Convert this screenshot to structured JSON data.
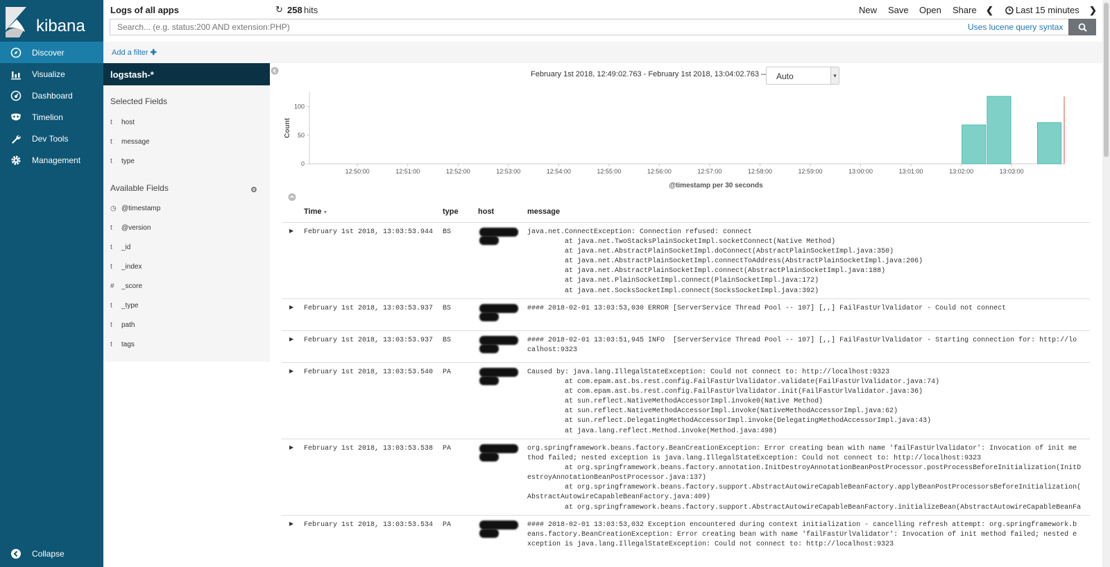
{
  "sidebar": {
    "logo": "kibana",
    "items": [
      {
        "label": "Discover",
        "icon": "compass-icon",
        "active": true
      },
      {
        "label": "Visualize",
        "icon": "bar-chart-icon",
        "active": false
      },
      {
        "label": "Dashboard",
        "icon": "dashboard-icon",
        "active": false
      },
      {
        "label": "Timelion",
        "icon": "timelion-mask-icon",
        "active": false
      },
      {
        "label": "Dev Tools",
        "icon": "wrench-icon",
        "active": false
      },
      {
        "label": "Management",
        "icon": "gear-icon",
        "active": false
      }
    ],
    "collapse_label": "Collapse"
  },
  "topbar": {
    "title": "Logs of all apps",
    "hits_count": "258",
    "hits_label": "hits",
    "new": "New",
    "save": "Save",
    "open": "Open",
    "share": "Share",
    "time_range": "Last 15 minutes"
  },
  "search": {
    "placeholder": "Search... (e.g. status:200 AND extension:PHP)",
    "syntax_link": "Uses lucene query syntax"
  },
  "filters": {
    "add_label": "Add a filter"
  },
  "fieldpanel": {
    "index_pattern": "logstash-*",
    "selected_title": "Selected Fields",
    "selected": [
      {
        "type": "t",
        "name": "host"
      },
      {
        "type": "t",
        "name": "message"
      },
      {
        "type": "t",
        "name": "type"
      }
    ],
    "available_title": "Available Fields",
    "available": [
      {
        "type": "clock",
        "name": "@timestamp"
      },
      {
        "type": "t",
        "name": "@version"
      },
      {
        "type": "t",
        "name": "_id"
      },
      {
        "type": "t",
        "name": "_index"
      },
      {
        "type": "#",
        "name": "_score"
      },
      {
        "type": "t",
        "name": "_type"
      },
      {
        "type": "t",
        "name": "path"
      },
      {
        "type": "t",
        "name": "tags"
      }
    ]
  },
  "histogram": {
    "date_range": "February 1st 2018, 12:49:02.763 - February 1st 2018, 13:04:02.763 —",
    "interval": "Auto"
  },
  "chart_data": {
    "type": "bar",
    "ylabel": "Count",
    "xlabel": "@timestamp per 30 seconds",
    "ylim": [
      0,
      125
    ],
    "yticks": [
      0,
      50,
      100
    ],
    "x_ticks": [
      "12:50:00",
      "12:51:00",
      "12:52:00",
      "12:53:00",
      "12:54:00",
      "12:55:00",
      "12:56:00",
      "12:57:00",
      "12:58:00",
      "12:59:00",
      "13:00:00",
      "13:01:00",
      "13:02:00",
      "13:03:00"
    ],
    "x_range_seconds": [
      0,
      900
    ],
    "bars": [
      {
        "start": "13:02:00",
        "value": 68
      },
      {
        "start": "13:02:30",
        "value": 118
      },
      {
        "start": "13:03:30",
        "value": 72
      }
    ],
    "color": "#7fd1c7",
    "now_marker_color": "#e74c3c"
  },
  "table": {
    "headers": {
      "time": "Time",
      "type": "type",
      "host": "host",
      "message": "message"
    },
    "rows": [
      {
        "time": "February 1st 2018, 13:03:53.944",
        "type": "BS",
        "message": "java.net.ConnectException: Connection refused: connect\n\tat java.net.TwoStacksPlainSocketImpl.socketConnect(Native Method)\n\tat java.net.AbstractPlainSocketImpl.doConnect(AbstractPlainSocketImpl.java:350)\n\tat java.net.AbstractPlainSocketImpl.connectToAddress(AbstractPlainSocketImpl.java:206)\n\tat java.net.AbstractPlainSocketImpl.connect(AbstractPlainSocketImpl.java:188)\n\tat java.net.PlainSocketImpl.connect(PlainSocketImpl.java:172)\n\tat java.net.SocksSocketImpl.connect(SocksSocketImpl.java:392)"
      },
      {
        "time": "February 1st 2018, 13:03:53.937",
        "type": "BS",
        "message": "#### 2018-02-01 13:03:53,030 ERROR [ServerService Thread Pool -- 107] [,,] FailFastUrlValidator - Could not connect"
      },
      {
        "time": "February 1st 2018, 13:03:53.937",
        "type": "BS",
        "message": "#### 2018-02-01 13:03:51,945 INFO  [ServerService Thread Pool -- 107] [,,] FailFastUrlValidator - Starting connection for: http://lo\ncalhost:9323"
      },
      {
        "time": "February 1st 2018, 13:03:53.540",
        "type": "PA",
        "message": "Caused by: java.lang.IllegalStateException: Could not connect to: http://localhost:9323\n\tat com.epam.ast.bs.rest.config.FailFastUrlValidator.validate(FailFastUrlValidator.java:74)\n\tat com.epam.ast.bs.rest.config.FailFastUrlValidator.init(FailFastUrlValidator.java:36)\n\tat sun.reflect.NativeMethodAccessorImpl.invoke0(Native Method)\n\tat sun.reflect.NativeMethodAccessorImpl.invoke(NativeMethodAccessorImpl.java:62)\n\tat sun.reflect.DelegatingMethodAccessorImpl.invoke(DelegatingMethodAccessorImpl.java:43)\n\tat java.lang.reflect.Method.invoke(Method.java:498)"
      },
      {
        "time": "February 1st 2018, 13:03:53.538",
        "type": "PA",
        "message": "org.springframework.beans.factory.BeanCreationException: Error creating bean with name 'failFastUrlValidator': Invocation of init me\nthod failed; nested exception is java.lang.IllegalStateException: Could not connect to: http://localhost:9323\n\tat org.springframework.beans.factory.annotation.InitDestroyAnnotationBeanPostProcessor.postProcessBeforeInitialization(InitD\nestroyAnnotationBeanPostProcessor.java:137)\n\tat org.springframework.beans.factory.support.AbstractAutowireCapableBeanFactory.applyBeanPostProcessorsBeforeInitialization(\nAbstractAutowireCapableBeanFactory.java:409)\n\tat org.springframework.beans.factory.support.AbstractAutowireCapableBeanFactory.initializeBean(AbstractAutowireCapableBeanFa"
      },
      {
        "time": "February 1st 2018, 13:03:53.534",
        "type": "PA",
        "message": "#### 2018-02-01 13:03:53,032 Exception encountered during context initialization - cancelling refresh attempt: org.springframework.b\neans.factory.BeanCreationException: Error creating bean with name 'failFastUrlValidator': Invocation of init method failed; nested e\nxception is java.lang.IllegalStateException: Could not connect to: http://localhost:9323"
      }
    ]
  }
}
